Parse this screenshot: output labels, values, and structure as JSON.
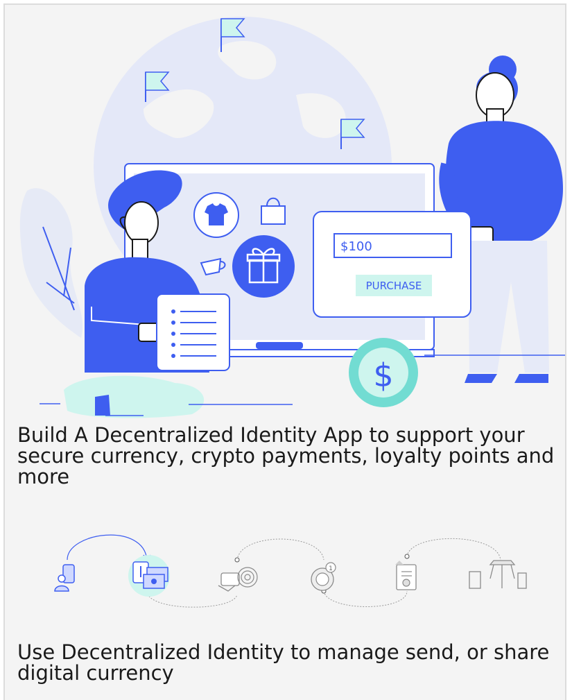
{
  "hero": {
    "price": "$100",
    "purchase_label": "PURCHASE",
    "currency_symbol": "$"
  },
  "headline": "Build A Decentralized Identity App to support your secure currency, crypto payments, loyalty points and more",
  "flow": {
    "steps": [
      "phone-user-icon",
      "cash-exchange-icon",
      "fingerprint-card-icon",
      "reward-coin-icon",
      "certificate-icon",
      "amusement-park-icon"
    ],
    "badge_number": "1"
  },
  "subline": "Use Decentralized Identity to manage send, or share digital currency",
  "colors": {
    "accent": "#3e5ef0",
    "mint": "#cef5ee",
    "teal": "#72dcd2",
    "globe": "#e4e8f8",
    "screen": "#e6eaf8"
  }
}
